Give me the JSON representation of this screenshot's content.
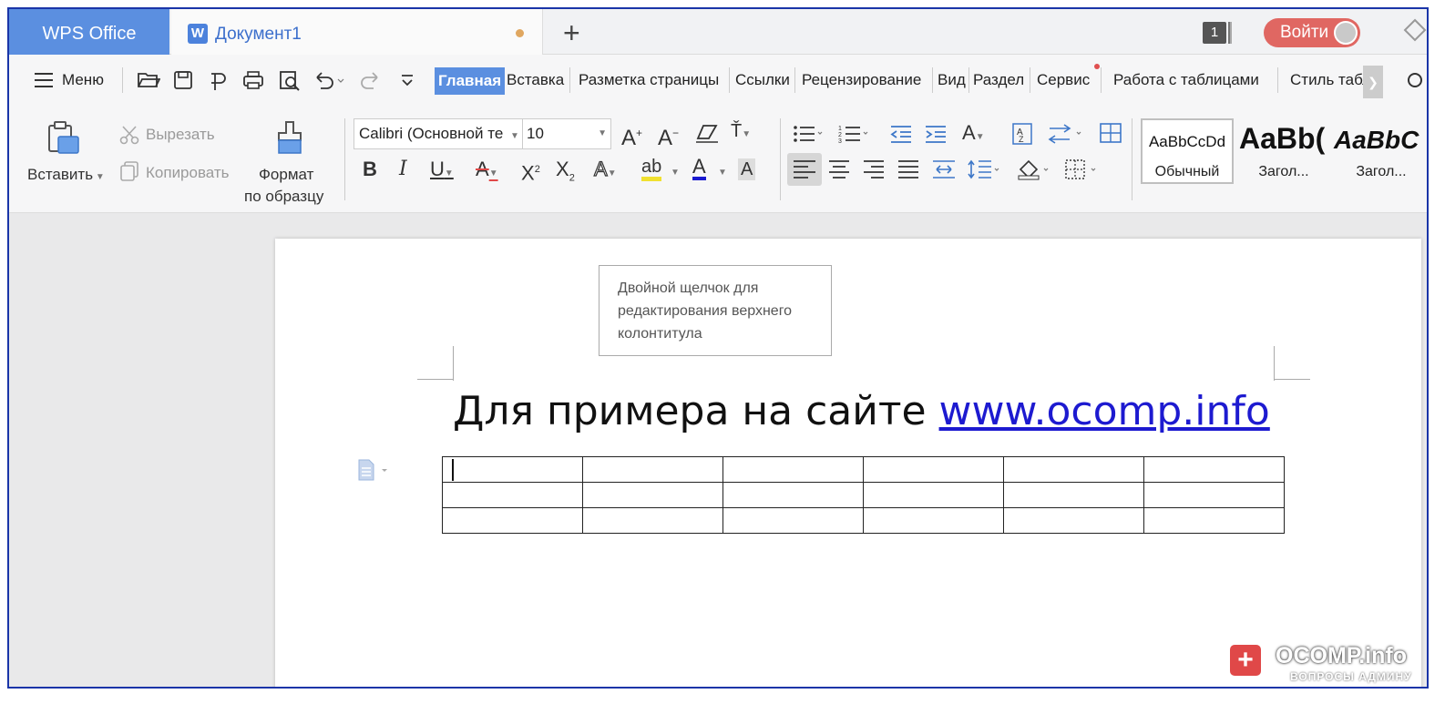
{
  "tabbar": {
    "app_name": "WPS Office",
    "doc_tab": "Документ1",
    "doc_icon": "W",
    "new_tab": "+",
    "window_count": "1",
    "login": "Войти"
  },
  "menu": {
    "menu_label": "Меню",
    "tabs": [
      "Главная",
      "Вставка",
      "Разметка страницы",
      "Ссылки",
      "Рецензирование",
      "Вид",
      "Раздел",
      "Сервис",
      "Работа с таблицами",
      "Стиль табл"
    ],
    "active_tab": "Главная"
  },
  "ribbon": {
    "paste": "Вставить",
    "cut": "Вырезать",
    "copy": "Копировать",
    "format_painter_line1": "Формат",
    "format_painter_line2": "по образцу",
    "font_name": "Calibri (Основной те",
    "font_size": "10",
    "styles": [
      {
        "preview": "AaBbCcDd",
        "label": "Обычный"
      },
      {
        "preview": "AaBb(",
        "label": "Загол..."
      },
      {
        "preview": "AaBbC",
        "label": "Загол..."
      }
    ]
  },
  "document": {
    "header_tip": "Двойной щелчок для редактирования верхнего колонтитула",
    "heading_text": "Для примера на сайте ",
    "heading_link": "www.ocomp.info",
    "table": {
      "rows": 3,
      "cols": 6
    }
  },
  "watermark": {
    "name": "OCOMP.info",
    "sub": "ВОПРОСЫ АДМИНУ"
  },
  "colors": {
    "accent": "#5b8fe0",
    "login": "#e06762",
    "link": "#1d1ad0",
    "frame_border": "#1a35a8"
  }
}
